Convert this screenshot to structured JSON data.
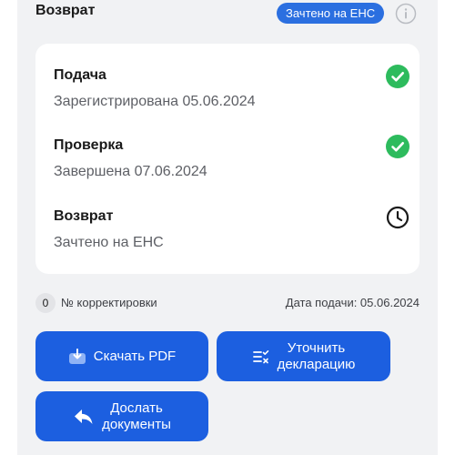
{
  "header": {
    "title": "Возврат",
    "status_badge": "Зачтено на ЕНС",
    "info_icon": "info-circle-icon"
  },
  "steps": [
    {
      "title": "Подача",
      "subtitle": "Зарегистрирована 05.06.2024",
      "icon": "check-circle-icon",
      "icon_color": "#2dbb5d"
    },
    {
      "title": "Проверка",
      "subtitle": "Завершена 07.06.2024",
      "icon": "check-circle-icon",
      "icon_color": "#2dbb5d"
    },
    {
      "title": "Возврат",
      "subtitle": "Зачтено на ЕНС",
      "icon": "clock-icon",
      "icon_color": "#1a1a1a"
    }
  ],
  "meta": {
    "correction_count": "0",
    "correction_label": "№ корректировки",
    "filing_date": "Дата подачи: 05.06.2024"
  },
  "actions": {
    "download_pdf": "Скачать PDF",
    "clarify_line1": "Уточнить",
    "clarify_line2": "декларацию",
    "send_docs_line1": "Дослать",
    "send_docs_line2": "документы"
  },
  "colors": {
    "accent": "#1c5fe0",
    "success": "#2dbb5d",
    "background": "#f1f2f4"
  }
}
